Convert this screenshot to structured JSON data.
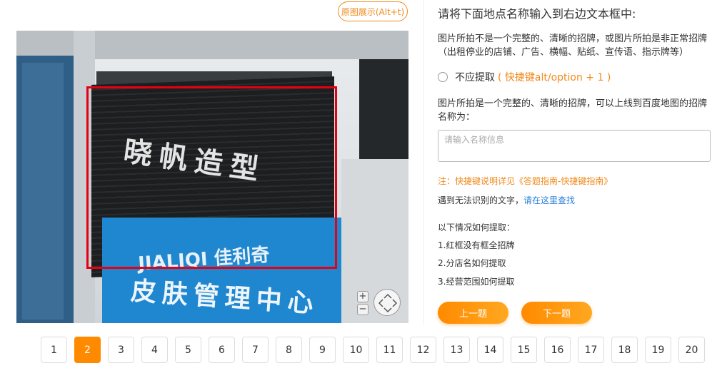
{
  "image_panel": {
    "original_button": "原图展示(Alt+t)",
    "zoom_in": "+",
    "zoom_out": "−",
    "photo_text": {
      "sign_main": "晓帆造型",
      "sign_blue_en": "JIALIQI 佳利奇",
      "sign_blue_cn": "皮肤管理中心"
    }
  },
  "form": {
    "title": "请将下面地点名称输入到右边文本框中:",
    "case_invalid": "图片所拍不是一个完整的、清晰的招牌，或图片所拍是非正常招牌（出租停业的店铺、广告、横幅、贴纸、宣传语、指示牌等）",
    "radio_label": "不应提取",
    "radio_shortcut": "( 快捷键alt/option + 1 )",
    "case_valid": "图片所拍是一个完整的、清晰的招牌，可以上线到百度地图的招牌名称为：",
    "input_placeholder": "请输入名称信息",
    "input_value": "",
    "note": "注：快捷键说明详见《答题指南-快捷键指南》",
    "help_text": "遇到无法识别的文字，",
    "help_link": "请在这里查找",
    "faq_heading": "以下情况如何提取：",
    "faq_items": [
      "1.红框没有框全招牌",
      "2.分店名如何提取",
      "3.经营范围如何提取"
    ],
    "prev_button": "上一题",
    "next_button": "下一题"
  },
  "pagination": {
    "active": "2",
    "pages": [
      "1",
      "2",
      "3",
      "4",
      "5",
      "6",
      "7",
      "8",
      "9",
      "10",
      "11",
      "12",
      "13",
      "14",
      "15",
      "16",
      "17",
      "18",
      "19",
      "20"
    ]
  },
  "colors": {
    "accent": "#ff8a00",
    "link": "#2b7fd9",
    "highlight_box": "#e60012"
  }
}
